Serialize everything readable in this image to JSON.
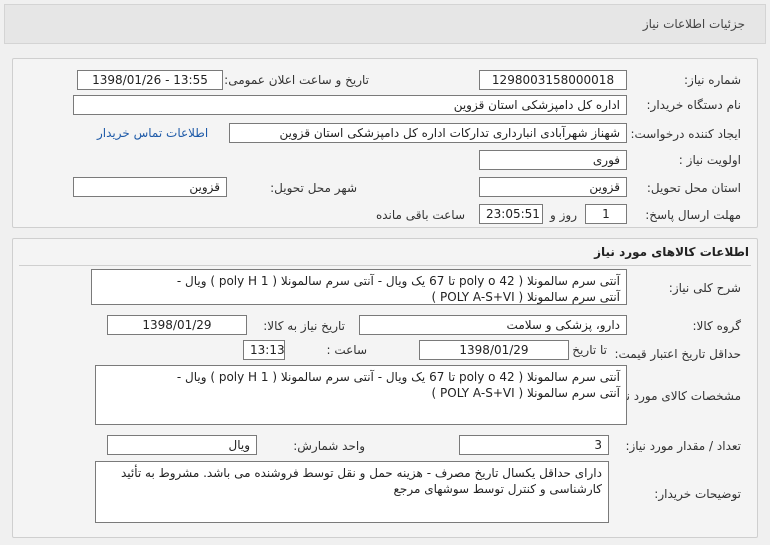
{
  "header": {
    "title": "جزئیات اطلاعات نیاز"
  },
  "info": {
    "need_number_label": "شماره نیاز:",
    "need_number": "1298003158000018",
    "announce_label": "تاریخ و ساعت اعلان عمومی:",
    "announce_value": "1398/01/26 - 13:55",
    "buyer_org_label": "نام دستگاه خریدار:",
    "buyer_org": "اداره کل دامپزشکی استان قزوین",
    "creator_label": "ایجاد کننده درخواست:",
    "creator": "شهناز شهرآبادی انبارداری تدارکات اداره کل دامپزشکی استان قزوین",
    "contact_link": "اطلاعات تماس خریدار",
    "priority_label": "اولویت نیاز :",
    "priority": "فوری",
    "province_label": "استان محل تحویل:",
    "province": "قزوین",
    "city_label": "شهر محل تحویل:",
    "city": "قزوین",
    "deadline_label": "مهلت ارسال پاسخ:",
    "deadline_days": "1",
    "days_word": "روز و",
    "deadline_time": "23:05:51",
    "remaining_label": "ساعت باقی مانده"
  },
  "goods": {
    "section_title": "اطلاعات کالاهای مورد نیاز",
    "summary_label": "شرح کلی نیاز:",
    "summary_line1": "آنتی سرم سالمونلا ( 42 poly o تا 67  یک ویال - آنتی سرم سالمونلا ( 1 poly H ) ویال -",
    "summary_line2": "آنتی سرم سالمونلا ( POLY A-S+VI )",
    "group_label": "گروه کالا:",
    "group": "دارو، پزشکی و سلامت",
    "need_date_label": "تاریخ نیاز به کالا:",
    "need_date": "1398/01/29",
    "validity_label": "حداقل تاریخ اعتبار قیمت:",
    "to_date_label": "تا تاریخ :",
    "validity_date": "1398/01/29",
    "time_label": "ساعت :",
    "validity_time": "13:13",
    "specs_label": "مشخصات کالای مورد نیاز:",
    "specs_line1": "آنتی سرم سالمونلا ( 42 poly o تا 67  یک ویال - آنتی سرم سالمونلا ( 1 poly H ) ویال -",
    "specs_line2": "آنتی سرم سالمونلا ( POLY A-S+VI )",
    "qty_label": "تعداد / مقدار مورد نیاز:",
    "qty": "3",
    "unit_label": "واحد شمارش:",
    "unit": "ویال",
    "notes_label": "توضیحات خریدار:",
    "notes_line1": "دارای حداقل یکسال تاریخ مصرف - هزینه حمل و نقل توسط فروشنده می باشد. مشروط به تأئید",
    "notes_line2": "کارشناسی و کنترل توسط سوشهای مرجع"
  }
}
